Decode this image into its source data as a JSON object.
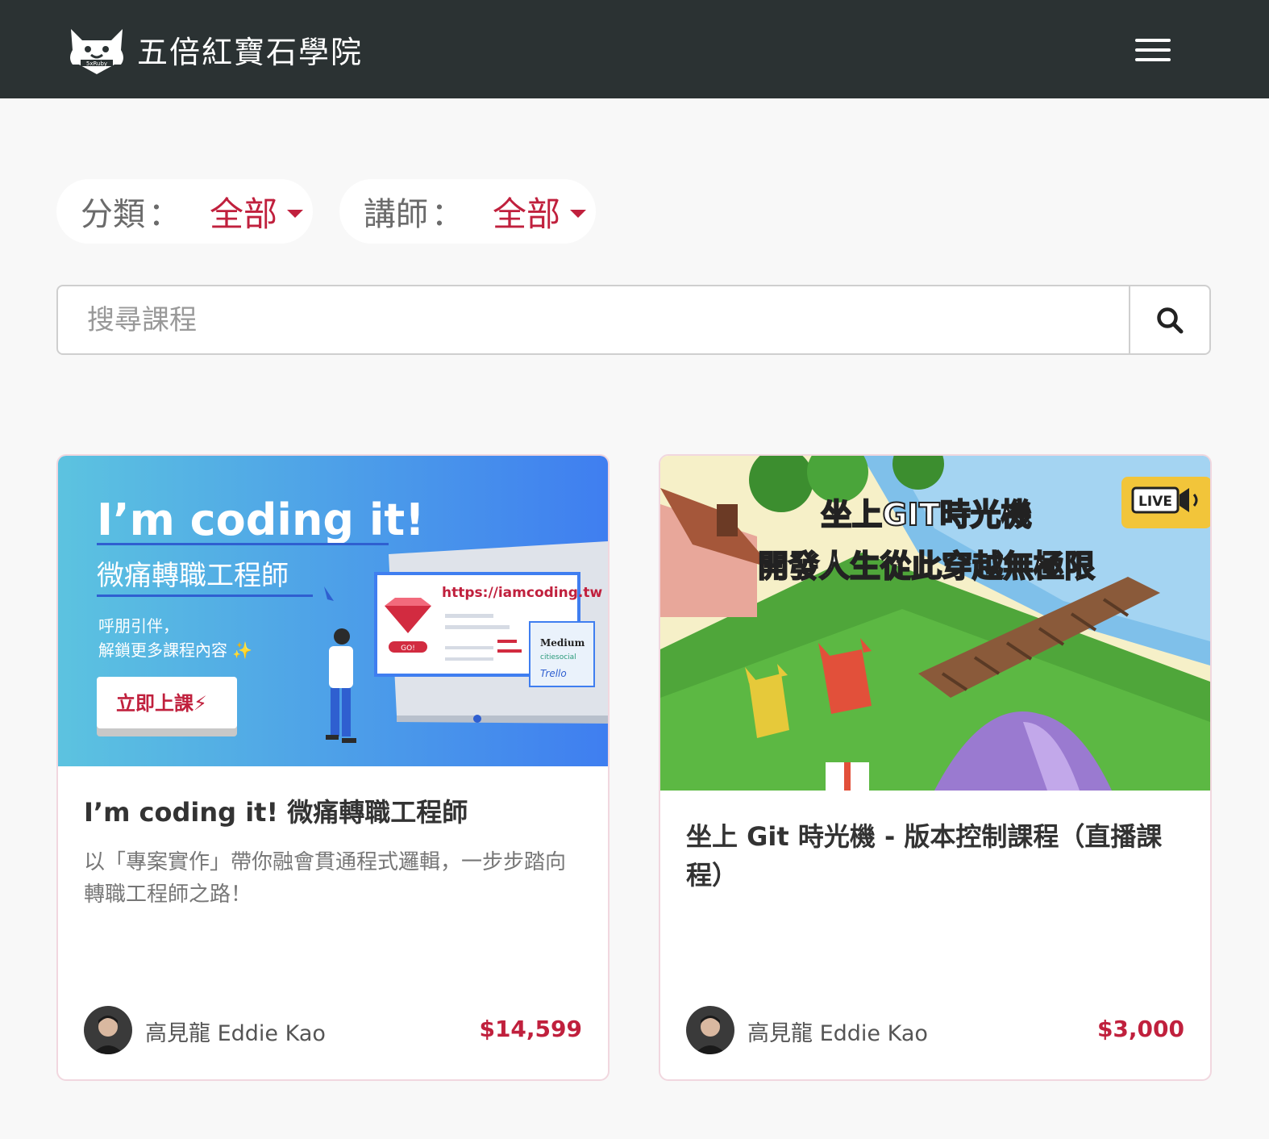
{
  "colors": {
    "navbar_bg": "#2b3233",
    "accent": "#c0203d",
    "page_bg": "#f8f8f8"
  },
  "header": {
    "logo_icon": "ruby-mascot-logo",
    "logo_text": "五倍紅寶石學院",
    "menu_icon": "hamburger-menu-icon"
  },
  "filters": [
    {
      "label": "分類",
      "colon": "：",
      "value": "全部"
    },
    {
      "label": "講師",
      "colon": "：",
      "value": "全部"
    }
  ],
  "search": {
    "placeholder": "搜尋課程",
    "value": "",
    "icon": "search-icon"
  },
  "courses": [
    {
      "banner": {
        "headline": "I’m coding it!",
        "subtitle": "微痛轉職工程師",
        "tagline_1": "呼朋引伴，",
        "tagline_2": "解鎖更多課程內容 ✨",
        "cta": "立即上課⚡",
        "url": "https://iamcoding.tw",
        "go": "GO!",
        "logos": [
          "Medium",
          "citiesocial",
          "Trello"
        ]
      },
      "title": "I’m coding it! 微痛轉職工程師",
      "description": "以「專案實作」帶你融會貫通程式邏輯，一步步踏向轉職工程師之路！",
      "teacher": "高見龍 Eddie Kao",
      "price": "$14,599"
    },
    {
      "banner": {
        "line_1": "坐上GIT時光機",
        "line_2": "開發人生從此穿越無極限",
        "live": "LIVE"
      },
      "title": "坐上 Git 時光機 - 版本控制課程（直播課程）",
      "description": "",
      "teacher": "高見龍 Eddie Kao",
      "price": "$3,000"
    }
  ]
}
